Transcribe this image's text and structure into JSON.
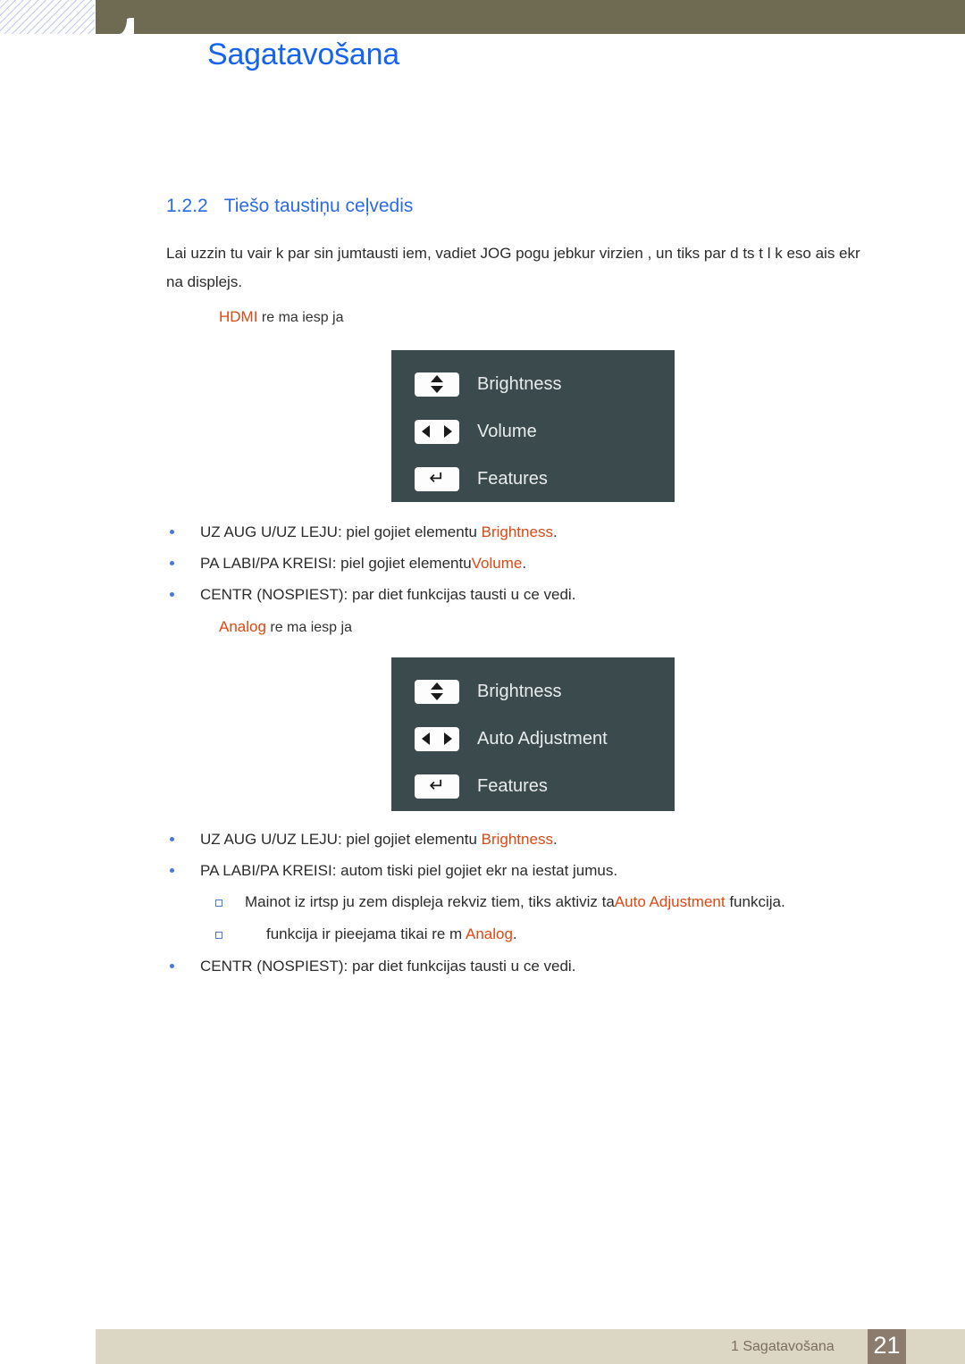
{
  "header": {
    "chapter_title": "Sagatavošana",
    "band_color": "#6e6b52"
  },
  "section": {
    "number": "1.2.2",
    "title": "Tiešo taustiņu ceļvedis",
    "heading_color": "#2a6ae8"
  },
  "intro_paragraph": "Lai uzzin tu vair k par  sin jumtausti iem, vadiet JOG pogu jebkur  virzien , un tiks par d ts t l k eso ais ekr na displejs.",
  "hdmi_mode": {
    "keyword": "HDMI",
    "rest": " re  ma iesp ja",
    "keyword_color": "#dd4814"
  },
  "analog_mode": {
    "keyword": "Analog",
    "rest": " re  ma iesp ja",
    "keyword_color": "#dd4814"
  },
  "osd_hdmi": {
    "background": "#3b4a4c",
    "rows": [
      {
        "icon": "up-down-arrows-icon",
        "label": "Brightness"
      },
      {
        "icon": "left-right-arrows-icon",
        "label": "Volume"
      },
      {
        "icon": "enter-return-arrow-icon",
        "label": "Features"
      }
    ]
  },
  "osd_analog": {
    "background": "#3b4a4c",
    "rows": [
      {
        "icon": "up-down-arrows-icon",
        "label": "Brightness"
      },
      {
        "icon": "left-right-arrows-icon",
        "label": "Auto Adjustment"
      },
      {
        "icon": "enter-return-arrow-icon",
        "label": "Features"
      }
    ]
  },
  "hdmi_bullets": {
    "b1_pre": "UZ AUG U/UZ LEJU: piel gojiet elementu ",
    "b1_kw": "Brightness",
    "b1_post": ".",
    "b2_pre": "PA LABI/PA KREISI: piel gojiet elementu",
    "b2_kw": "Volume",
    "b2_post": ".",
    "b3": "CENTR (NOSPIEST): par diet funkcijas tausti u ce vedi."
  },
  "analog_bullets": {
    "b1_pre": "UZ AUG U/UZ LEJU: piel gojiet elementu ",
    "b1_kw": "Brightness",
    "b1_post": ".",
    "b2": "PA LABI/PA KREISI: autom tiski piel gojiet ekr na iestat jumus.",
    "s1_pre": "Mainot iz irtsp ju zem displeja  rekviz tiem, tiks aktiviz ta",
    "s1_kw": "Auto Adjustment",
    "s1_post": " funkcija.",
    "s2_pre": "funkcija ir pieejama tikai re  m  ",
    "s2_kw": "Analog",
    "s2_post": ".",
    "b3": "CENTR (NOSPIEST): par diet funkcijas tausti u ce vedi."
  },
  "footer": {
    "label": "1 Sagatavošana",
    "page_number": "21",
    "band_color": "#dcd6c4",
    "page_box_color": "#8b7c6e"
  }
}
